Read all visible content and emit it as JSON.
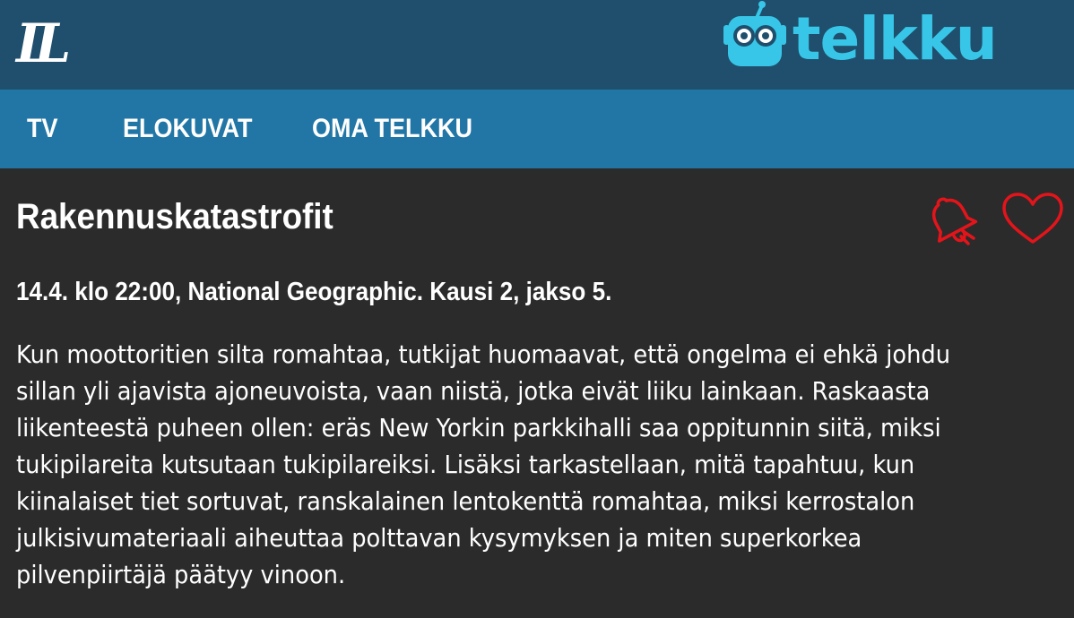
{
  "header": {
    "site_logo": "IL",
    "brand_logo": "telkku",
    "colors": {
      "header_bg": "#1f4f6d",
      "brand": "#38c6e8"
    }
  },
  "nav": {
    "items": [
      {
        "label": "TV"
      },
      {
        "label": "ELOKUVAT"
      },
      {
        "label": "OMA TELKKU"
      }
    ],
    "bg_color": "#2276a6"
  },
  "program": {
    "title": "Rakennuskatastrofit",
    "meta": "14.4. klo 22:00, National Geographic. Kausi 2, jakso 5.",
    "description_lines": [
      "Kun moottoritien silta romahtaa, tutkijat huomaavat, että ongelma ei ehkä johdu",
      "sillan yli ajavista ajoneuvoista, vaan niistä, jotka eivät liiku lainkaan. Raskaasta",
      "liikenteestä puheen ollen: eräs New Yorkin parkkihalli saa oppitunnin siitä, miksi",
      "tukipilareita kutsutaan tukipilareiksi. Lisäksi tarkastellaan, mitä tapahtuu, kun",
      "kiinalaiset tiet sortuvat, ranskalainen lentokenttä romahtaa, miksi kerrostalon",
      "julkisivumateriaali aiheuttaa polttavan kysymyksen ja miten superkorkea",
      "pilvenpiirtäjä päätyy vinoon."
    ],
    "actions": {
      "reminder_icon": "bell-icon",
      "favorite_icon": "heart-icon",
      "icon_color": "#e4141b"
    }
  }
}
